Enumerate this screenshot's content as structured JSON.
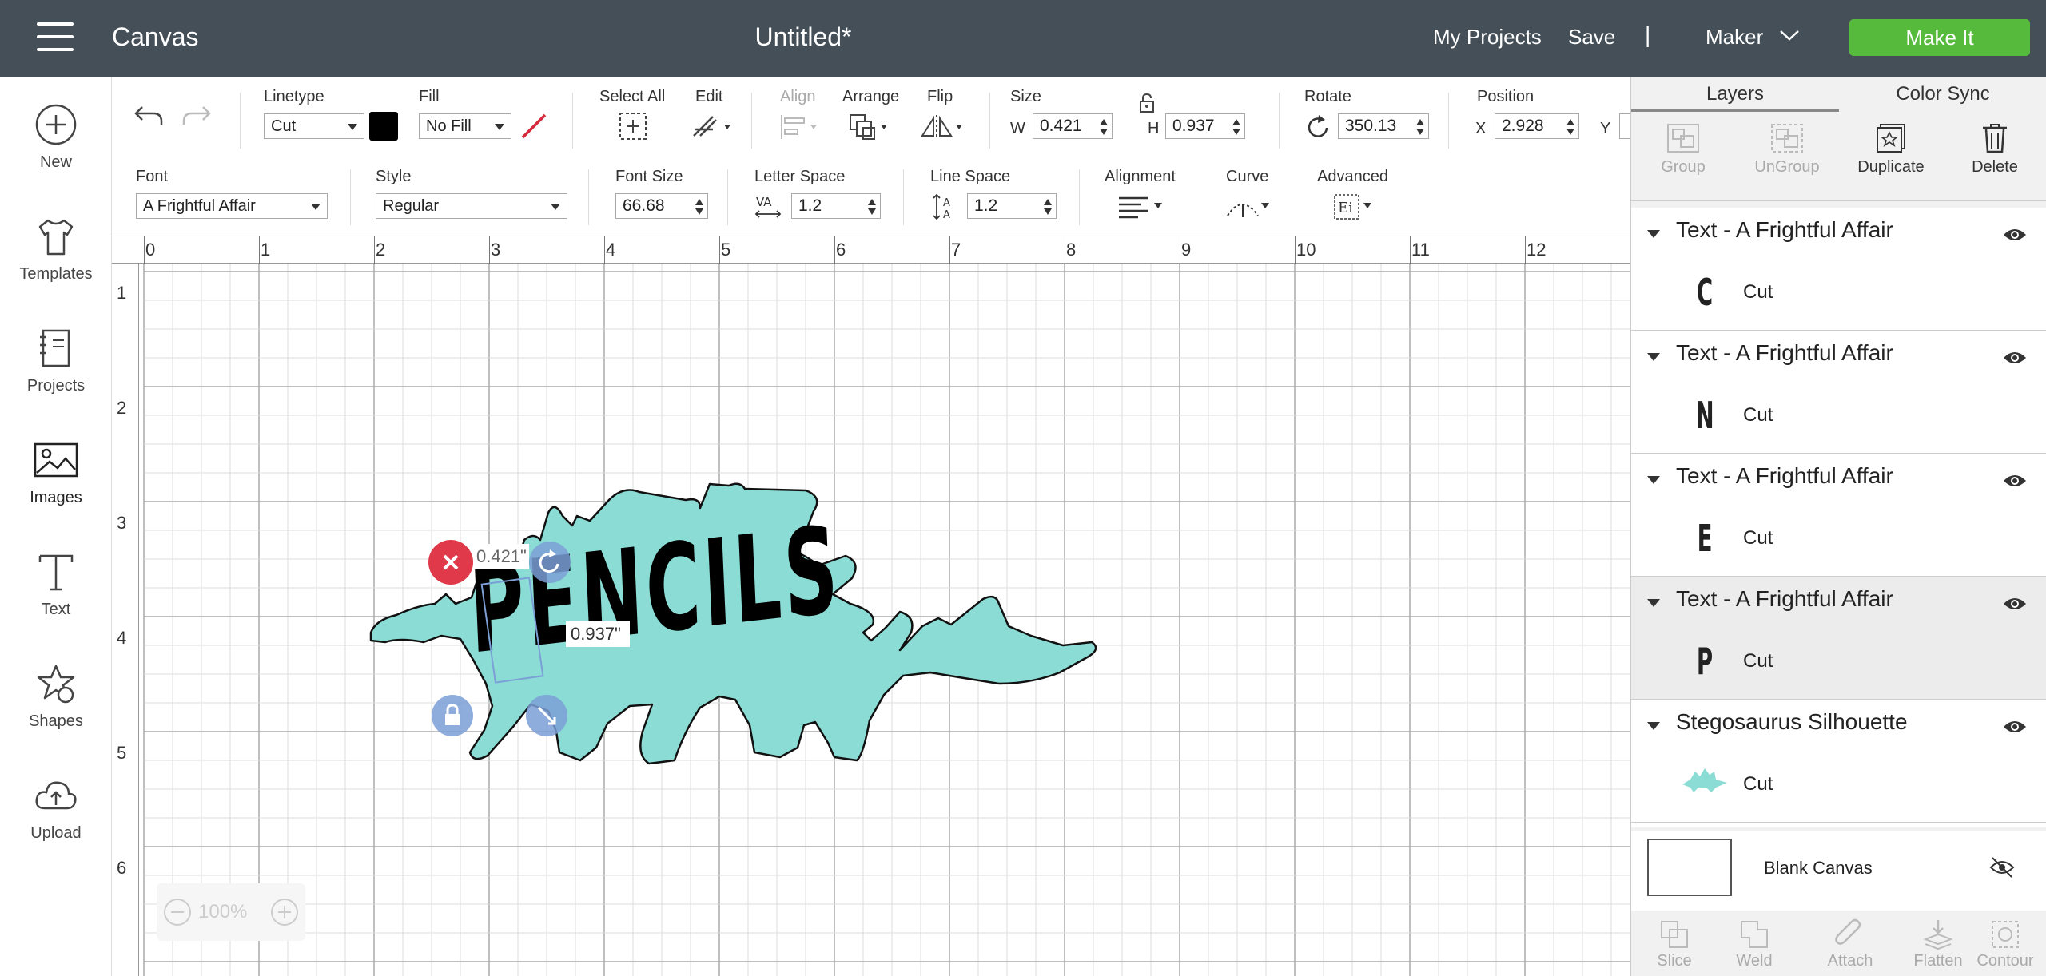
{
  "header": {
    "app_title": "Canvas",
    "doc_title": "Untitled*",
    "my_projects": "My Projects",
    "save": "Save",
    "separator": "|",
    "machine": "Maker",
    "make_it": "Make It"
  },
  "sidebar": {
    "items": [
      {
        "label": "New",
        "icon": "plus-circle-icon"
      },
      {
        "label": "Templates",
        "icon": "tshirt-icon"
      },
      {
        "label": "Projects",
        "icon": "notebook-icon"
      },
      {
        "label": "Images",
        "icon": "image-icon"
      },
      {
        "label": "Text",
        "icon": "text-t-icon"
      },
      {
        "label": "Shapes",
        "icon": "shapes-icon"
      },
      {
        "label": "Upload",
        "icon": "cloud-upload-icon"
      }
    ]
  },
  "toolbar": {
    "linetype_label": "Linetype",
    "linetype_value": "Cut",
    "linetype_color": "#000000",
    "fill_label": "Fill",
    "fill_value": "No Fill",
    "select_all_label": "Select All",
    "edit_label": "Edit",
    "align_label": "Align",
    "arrange_label": "Arrange",
    "flip_label": "Flip",
    "size_label": "Size",
    "w_label": "W",
    "w_value": "0.421",
    "h_label": "H",
    "h_value": "0.937",
    "rotate_label": "Rotate",
    "rotate_value": "350.13",
    "position_label": "Position",
    "x_label": "X",
    "x_value": "2.928",
    "y_label": "Y",
    "font_label": "Font",
    "font_value": "A Frightful Affair",
    "style_label": "Style",
    "style_value": "Regular",
    "font_size_label": "Font Size",
    "font_size_value": "66.68",
    "letter_space_label": "Letter Space",
    "letter_space_value": "1.2",
    "line_space_label": "Line Space",
    "line_space_value": "1.2",
    "alignment_label": "Alignment",
    "curve_label": "Curve",
    "advanced_label": "Advanced"
  },
  "panel": {
    "tabs": [
      "Layers",
      "Color Sync"
    ],
    "tools": [
      {
        "label": "Group",
        "enabled": false
      },
      {
        "label": "UnGroup",
        "enabled": false
      },
      {
        "label": "Duplicate",
        "enabled": true
      },
      {
        "label": "Delete",
        "enabled": true
      }
    ],
    "layers": [
      {
        "name": "Text - A Frightful Affair",
        "glyph": "C",
        "op": "Cut"
      },
      {
        "name": "Text - A Frightful Affair",
        "glyph": "N",
        "op": "Cut"
      },
      {
        "name": "Text - A Frightful Affair",
        "glyph": "E",
        "op": "Cut"
      },
      {
        "name": "Text - A Frightful Affair",
        "glyph": "P",
        "op": "Cut"
      },
      {
        "name": "Stegosaurus Silhouette",
        "glyph": "",
        "op": "Cut"
      }
    ],
    "blank_canvas": "Blank Canvas",
    "bottom_tools": [
      "Slice",
      "Weld",
      "Attach",
      "Flatten",
      "Contour"
    ]
  },
  "canvas": {
    "ruler_top": [
      "0",
      "1",
      "2",
      "3",
      "4",
      "5",
      "6",
      "7",
      "8",
      "9",
      "10",
      "11",
      "12"
    ],
    "ruler_left": [
      "1",
      "2",
      "3",
      "4",
      "5",
      "6"
    ],
    "design_text": "PENCILS",
    "width_readout": "0.421\"",
    "height_readout": "0.937\"",
    "zoom": "100%",
    "silhouette_color": "#8adcd5",
    "accent_red": "#e03a4a",
    "handle_blue": "#7b9fd6"
  }
}
